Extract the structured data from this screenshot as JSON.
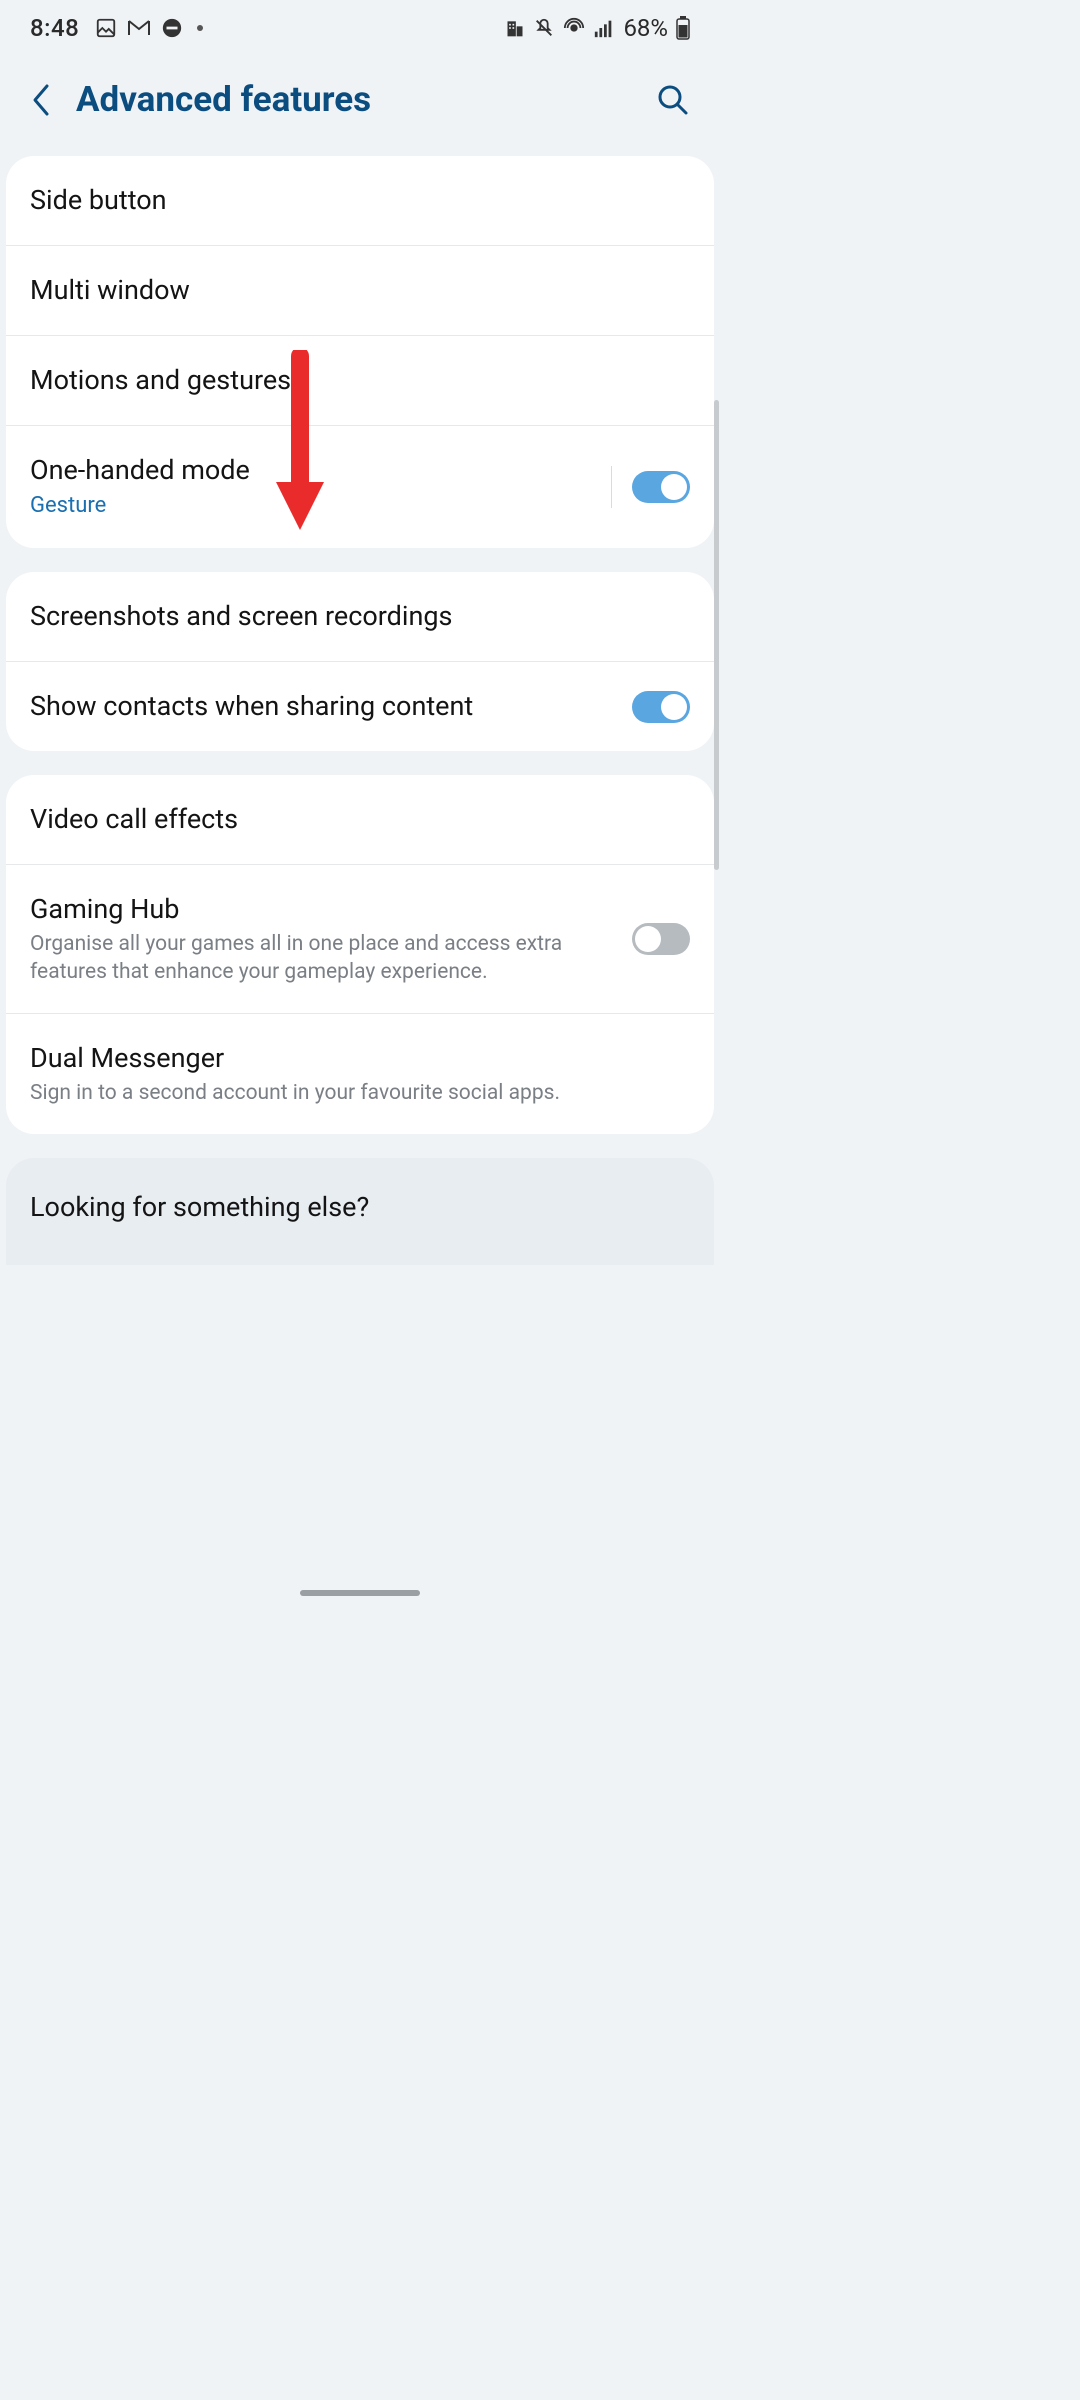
{
  "statusbar": {
    "time": "8:48",
    "battery": "68%"
  },
  "header": {
    "title": "Advanced features"
  },
  "groups": [
    {
      "items": [
        {
          "label": "Side button"
        },
        {
          "label": "Multi window"
        },
        {
          "label": "Motions and gestures"
        },
        {
          "label": "One-handed mode",
          "sub": "Gesture",
          "sub_accent": true,
          "toggle": true,
          "separated_toggle": true
        }
      ]
    },
    {
      "items": [
        {
          "label": "Screenshots and screen recordings"
        },
        {
          "label": "Show contacts when sharing content",
          "toggle": true
        }
      ]
    },
    {
      "items": [
        {
          "label": "Video call effects"
        },
        {
          "label": "Gaming Hub",
          "sub": "Organise all your games all in one place and access extra features that enhance your gameplay experience.",
          "toggle": false
        },
        {
          "label": "Dual Messenger",
          "sub": "Sign in to a second account in your favourite social apps."
        }
      ]
    }
  ],
  "suggest": {
    "title": "Looking for something else?"
  }
}
